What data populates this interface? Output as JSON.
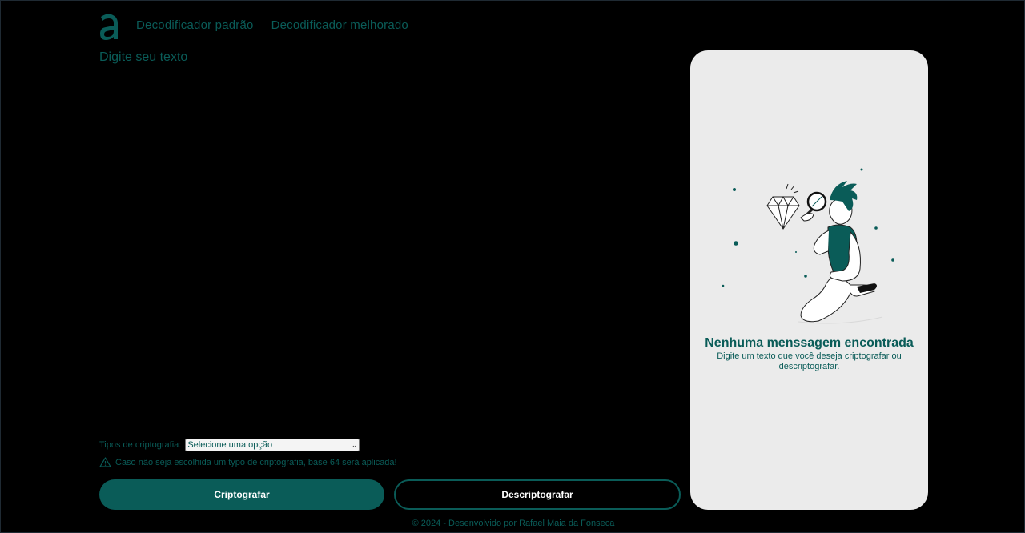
{
  "brand": {
    "logo_char": "a",
    "accent_color": "#0a5c58"
  },
  "nav": {
    "items": [
      {
        "label": "Decodificador padrão"
      },
      {
        "label": "Decodificador melhorado"
      }
    ]
  },
  "editor": {
    "label": "Digite seu texto",
    "value": ""
  },
  "crypto": {
    "label": "Tipos de criptografia:",
    "selected": "Selecione uma opção",
    "warning": "Caso não seja escolhida um typo de criptografia, base 64 será aplicada!"
  },
  "actions": {
    "encrypt_label": "Criptografar",
    "decrypt_label": "Descriptografar"
  },
  "output_panel": {
    "title": "Nenhuma menssagem encontrada",
    "subtitle": "Digite um texto que você deseja criptografar ou descriptografar.",
    "illustration_icon": "person-with-magnifier-diamond-illustration"
  },
  "footer": {
    "text": "© 2024 - Desenvolvido por Rafael Maia da Fonseca"
  }
}
